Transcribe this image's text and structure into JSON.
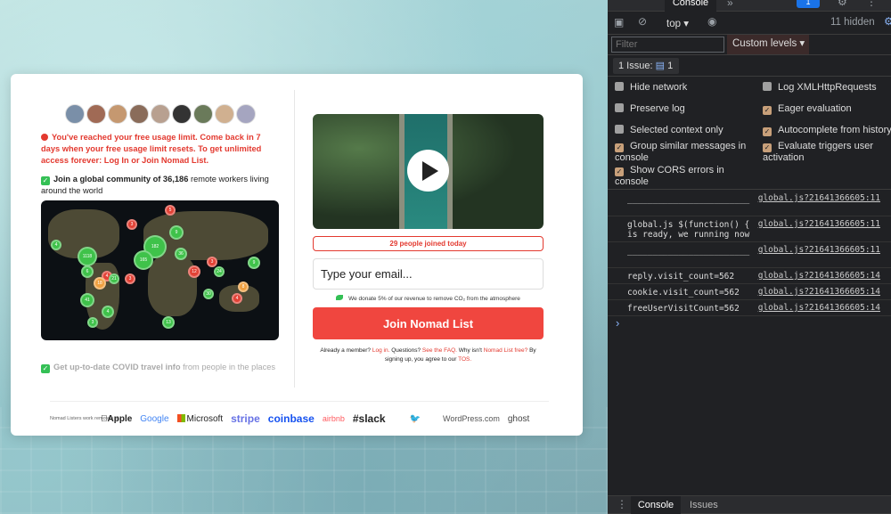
{
  "promo": {
    "warning": "You've reached your free usage limit. Come back in 7 days when your free usage limit resets. To get unlimited access forever: Log In or Join Nomad List.",
    "community_bold": "Join a global community of 36,186",
    "community_rest": "remote workers living around the world",
    "covid_bold": "Get up-to-date COVID travel info",
    "covid_rest": "from people in the places",
    "joined": "29 people joined today",
    "email_placeholder": "Type your email...",
    "donate": "We donate 5% of our revenue to remove CO₂ from the atmosphere",
    "join_button": "Join Nomad List",
    "already_prefix": "Already a member?",
    "login_link": "Log in.",
    "questions_prefix": "Questions?",
    "faq_link": "See the FAQ.",
    "why_prefix": "Why isn't",
    "free_link": "Nomad List free?",
    "signing": "By signing up, you agree to our",
    "tos_link": "TOS."
  },
  "map_clusters": [
    {
      "label": "4",
      "color": "g"
    },
    {
      "label": "3",
      "color": "r"
    },
    {
      "label": "5",
      "color": "r"
    },
    {
      "label": "9",
      "color": "g"
    },
    {
      "label": "182",
      "color": "g"
    },
    {
      "label": "36",
      "color": "g"
    },
    {
      "label": "1118",
      "color": "g"
    },
    {
      "label": "4",
      "color": "r"
    },
    {
      "label": "165",
      "color": "g"
    },
    {
      "label": "6",
      "color": "g"
    },
    {
      "label": "21",
      "color": "g"
    },
    {
      "label": "18",
      "color": "o"
    },
    {
      "label": "41",
      "color": "g"
    },
    {
      "label": "3",
      "color": "r"
    },
    {
      "label": "3",
      "color": "r"
    },
    {
      "label": "24",
      "color": "g"
    },
    {
      "label": "12",
      "color": "r"
    },
    {
      "label": "30",
      "color": "g"
    },
    {
      "label": "8",
      "color": "o"
    },
    {
      "label": "9",
      "color": "g"
    },
    {
      "label": "4",
      "color": "r"
    },
    {
      "label": "13",
      "color": "g"
    },
    {
      "label": "4",
      "color": "g"
    },
    {
      "label": "3",
      "color": "g"
    }
  ],
  "logos": {
    "caption": "Nomad Listers work remotely at",
    "items": [
      "Apple",
      "Google",
      "Microsoft",
      "stripe",
      "coinbase",
      "airbnb",
      "slack",
      "",
      "WordPress.com",
      "ghost"
    ]
  },
  "devtools": {
    "top_tab": "Console",
    "context": "top",
    "hidden": "11 hidden",
    "filter_placeholder": "Filter",
    "custom_levels": "Custom levels",
    "issues_label": "1 Issue:",
    "issues_count": "1",
    "issues_top": "1",
    "options_left": [
      {
        "label": "Hide network",
        "checked": false
      },
      {
        "label": "Preserve log",
        "checked": false
      },
      {
        "label": "Selected context only",
        "checked": false
      },
      {
        "label": "Group similar messages in console",
        "checked": true
      },
      {
        "label": "Show CORS errors in console",
        "checked": true
      }
    ],
    "options_right": [
      {
        "label": "Log XMLHttpRequests",
        "checked": false
      },
      {
        "label": "Eager evaluation",
        "checked": true
      },
      {
        "label": "Autocomplete from history",
        "checked": true
      },
      {
        "label": "Evaluate triggers user activation",
        "checked": true
      }
    ],
    "logs": [
      {
        "msg": "________________________",
        "src": "global.js?21641366605:11"
      },
      {
        "msg": "global.js $(function() { is ready, we running now",
        "src": "global.js?21641366605:11"
      },
      {
        "msg": "________________________",
        "src": "global.js?21641366605:11"
      },
      {
        "msg": "reply.visit_count=562",
        "src": "global.js?21641366605:14"
      },
      {
        "msg": "cookie.visit_count=562",
        "src": "global.js?21641366605:14"
      },
      {
        "msg": "freeUserVisitCount=562",
        "src": "global.js?21641366605:14"
      }
    ],
    "prompt": "›",
    "bottom_tabs": [
      "Console",
      "Issues"
    ]
  }
}
